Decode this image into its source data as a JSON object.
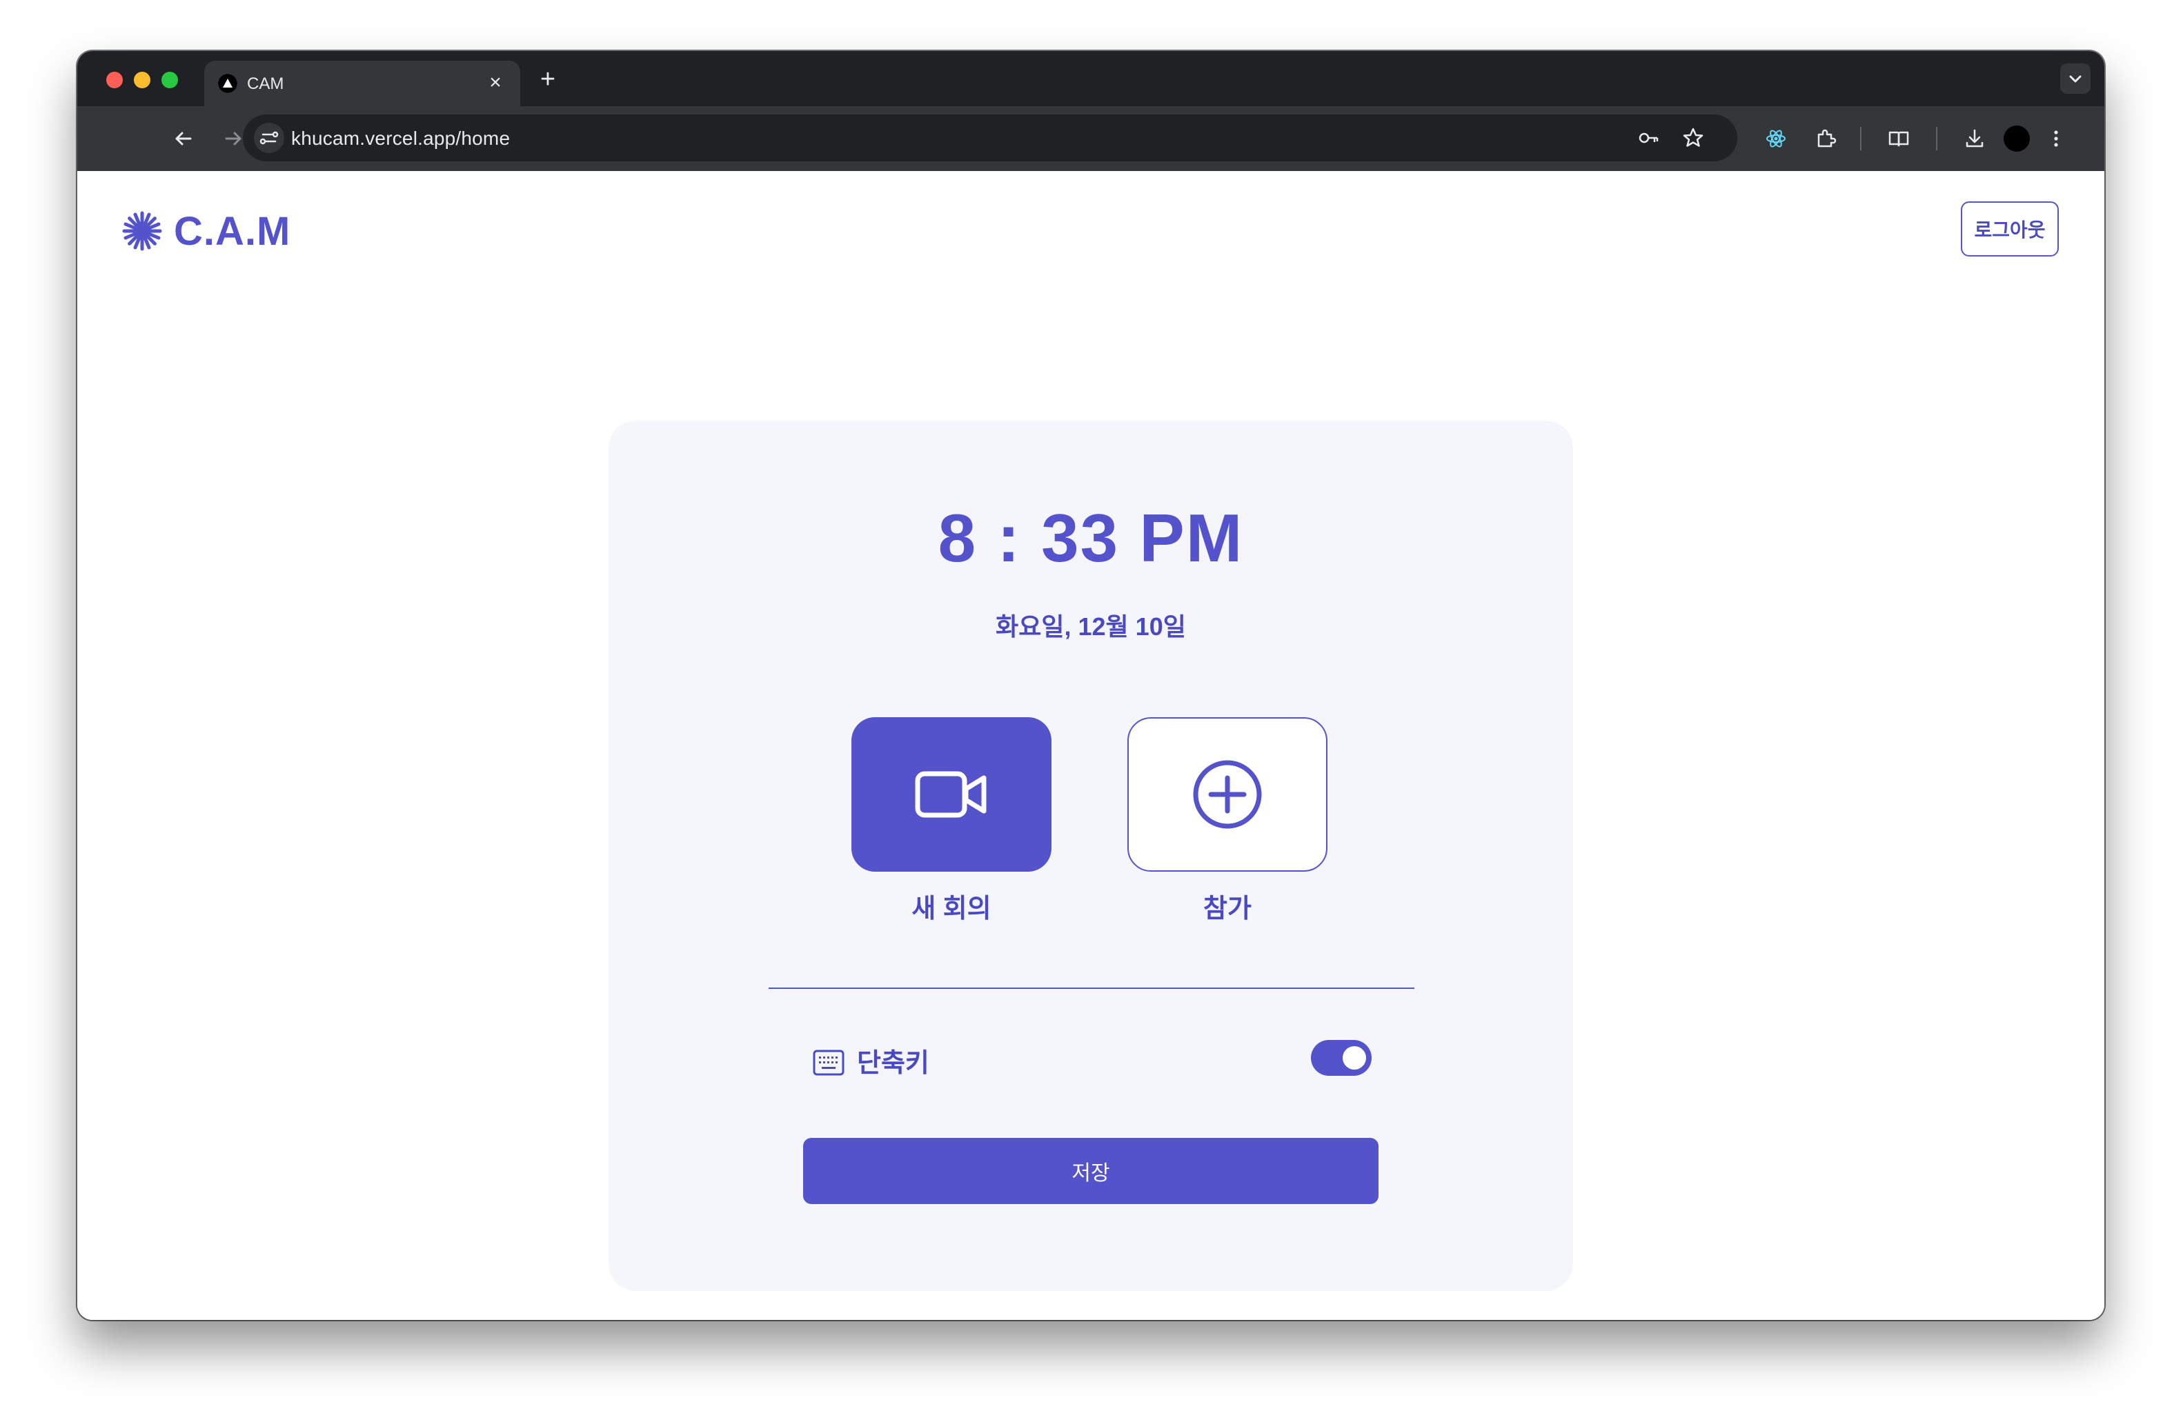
{
  "browser": {
    "tab": {
      "title": "CAM",
      "favicon": "vercel-triangle-icon"
    },
    "url": "khucam.vercel.app/home",
    "new_tab_label": "+",
    "close_tab_label": "×"
  },
  "header": {
    "logo_icon": "asterisk-sparkle-icon",
    "logo_text": "C.A.M",
    "logout_label": "로그아웃"
  },
  "card": {
    "time": "8 : 33 PM",
    "date": "화요일, 12월 10일",
    "actions": [
      {
        "label": "새 회의",
        "icon": "video-camera-icon"
      },
      {
        "label": "참가",
        "icon": "plus-circle-icon"
      }
    ],
    "shortcut": {
      "label": "단축키",
      "icon": "keyboard-icon",
      "enabled": true
    },
    "save_label": "저장"
  },
  "colors": {
    "accent": "#5553cc",
    "card_bg": "#f5f6fc",
    "chrome_dark": "#202124",
    "chrome_toolbar": "#35363a"
  }
}
